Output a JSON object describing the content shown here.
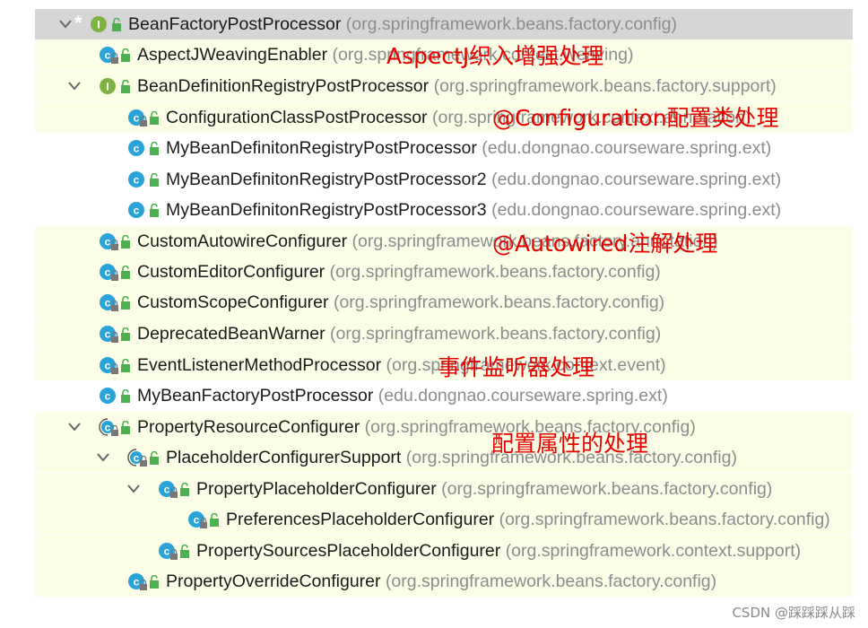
{
  "tree": {
    "rows": [
      {
        "name": "BeanFactoryPostProcessor",
        "pkg": "(org.springframework.beans.factory.config)",
        "kind": "interface",
        "expand": "expanded",
        "sub": false,
        "lock": false,
        "star": true,
        "level": 0
      },
      {
        "name": "AspectJWeavingEnabler",
        "pkg": "(org.springframework.context.weaving)",
        "kind": "class",
        "expand": "none",
        "sub": false,
        "lock": true,
        "star": false,
        "level": 1
      },
      {
        "name": "BeanDefinitionRegistryPostProcessor",
        "pkg": "(org.springframework.beans.factory.support)",
        "kind": "interface",
        "expand": "expanded",
        "sub": false,
        "lock": false,
        "star": false,
        "level": 1
      },
      {
        "name": "ConfigurationClassPostProcessor",
        "pkg": "(org.springframework.context.annotation)",
        "kind": "class",
        "expand": "none",
        "sub": false,
        "lock": true,
        "star": false,
        "level": 2
      },
      {
        "name": "MyBeanDefinitonRegistryPostProcessor",
        "pkg": "(edu.dongnao.courseware.spring.ext)",
        "kind": "class",
        "expand": "none",
        "sub": false,
        "lock": false,
        "star": false,
        "level": 2
      },
      {
        "name": "MyBeanDefinitonRegistryPostProcessor2",
        "pkg": "(edu.dongnao.courseware.spring.ext)",
        "kind": "class",
        "expand": "none",
        "sub": false,
        "lock": false,
        "star": false,
        "level": 2
      },
      {
        "name": "MyBeanDefinitonRegistryPostProcessor3",
        "pkg": "(edu.dongnao.courseware.spring.ext)",
        "kind": "class",
        "expand": "none",
        "sub": false,
        "lock": false,
        "star": false,
        "level": 2
      },
      {
        "name": "CustomAutowireConfigurer",
        "pkg": "(org.springframework.beans.factory.annotation)",
        "kind": "class",
        "expand": "none",
        "sub": false,
        "lock": true,
        "star": false,
        "level": 1
      },
      {
        "name": "CustomEditorConfigurer",
        "pkg": "(org.springframework.beans.factory.config)",
        "kind": "class",
        "expand": "none",
        "sub": false,
        "lock": true,
        "star": false,
        "level": 1
      },
      {
        "name": "CustomScopeConfigurer",
        "pkg": "(org.springframework.beans.factory.config)",
        "kind": "class",
        "expand": "none",
        "sub": false,
        "lock": true,
        "star": false,
        "level": 1
      },
      {
        "name": "DeprecatedBeanWarner",
        "pkg": "(org.springframework.beans.factory.config)",
        "kind": "class",
        "expand": "none",
        "sub": false,
        "lock": true,
        "star": false,
        "level": 1
      },
      {
        "name": "EventListenerMethodProcessor",
        "pkg": "(org.springframework.context.event)",
        "kind": "class",
        "expand": "none",
        "sub": false,
        "lock": true,
        "star": false,
        "level": 1
      },
      {
        "name": "MyBeanFactoryPostProcessor",
        "pkg": "(edu.dongnao.courseware.spring.ext)",
        "kind": "class",
        "expand": "none",
        "sub": false,
        "lock": false,
        "star": false,
        "level": 1
      },
      {
        "name": "PropertyResourceConfigurer",
        "pkg": "(org.springframework.beans.factory.config)",
        "kind": "abstract",
        "expand": "expanded",
        "sub": false,
        "lock": true,
        "star": false,
        "level": 1
      },
      {
        "name": "PlaceholderConfigurerSupport",
        "pkg": "(org.springframework.beans.factory.config)",
        "kind": "abstract",
        "expand": "expanded",
        "sub": false,
        "lock": true,
        "star": false,
        "level": 2
      },
      {
        "name": "PropertyPlaceholderConfigurer",
        "pkg": "(org.springframework.beans.factory.config)",
        "kind": "class",
        "expand": "expanded",
        "sub": false,
        "lock": true,
        "star": false,
        "level": 3
      },
      {
        "name": "PreferencesPlaceholderConfigurer",
        "pkg": "(org.springframework.beans.factory.config)",
        "kind": "class",
        "expand": "none",
        "sub": false,
        "lock": true,
        "star": false,
        "level": 4
      },
      {
        "name": "PropertySourcesPlaceholderConfigurer",
        "pkg": "(org.springframework.context.support)",
        "kind": "class",
        "expand": "none",
        "sub": false,
        "lock": true,
        "star": false,
        "level": 3
      },
      {
        "name": "PropertyOverrideConfigurer",
        "pkg": "(org.springframework.beans.factory.config)",
        "kind": "class",
        "expand": "none",
        "sub": false,
        "lock": true,
        "star": false,
        "level": 2
      }
    ]
  },
  "annotations": [
    {
      "text": "AspectJ织入增强处理"
    },
    {
      "text": "@Configuration配置类处理"
    },
    {
      "text": "@Autowired注解处理"
    },
    {
      "text": "事件监听器处理"
    },
    {
      "text": "配置属性的处理"
    }
  ],
  "watermark": "CSDN @踩踩踩从踩",
  "colors": {
    "class_icon": "#2aa3d9",
    "interface_icon": "#7cb342",
    "badge_green": "#4caf50",
    "annotation_red": "#e60000",
    "selected_row": "#d6d6d6",
    "hierarchy_row": "#fcfde6"
  }
}
